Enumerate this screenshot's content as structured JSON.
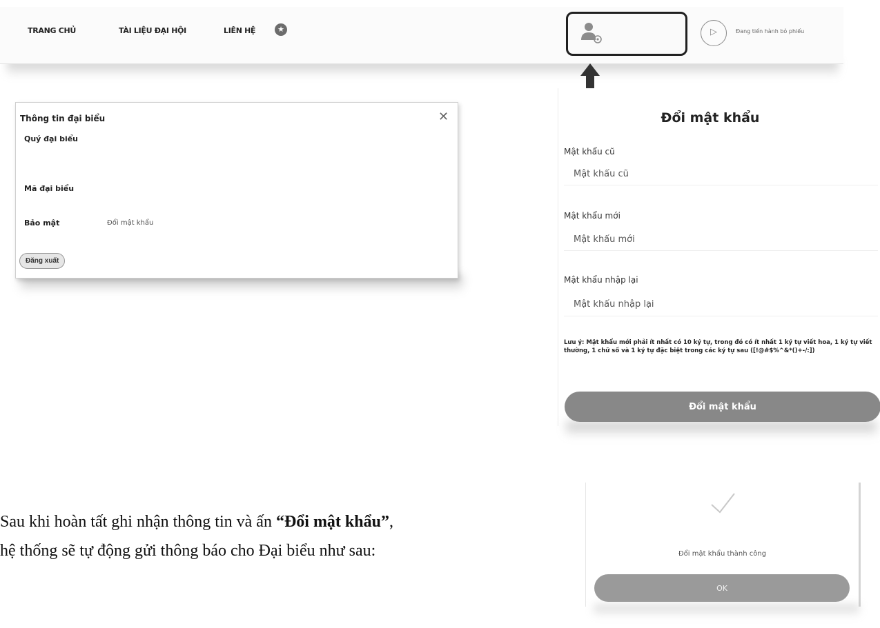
{
  "nav": {
    "home": "TRANG CHỦ",
    "documents": "TÀI LIỆU ĐẠI HỘI",
    "contact": "LIÊN HỆ",
    "voting_status": "Đang tiến hành bỏ phiếu",
    "star_icon": "star-icon",
    "user_icon": "user-settings-icon",
    "vote_icon": "send-icon"
  },
  "info_dialog": {
    "title": "Thông tin đại biểu",
    "label_title": "Quý đại biểu",
    "label_code": "Mã đại biểu",
    "label_security": "Bảo mật",
    "change_password_link": "Đổi mật khẩu",
    "logout_button": "Đăng xuất"
  },
  "change_password": {
    "title": "Đổi mật khẩu",
    "old_label": "Mật khẩu cũ",
    "old_placeholder": "Mật khẩu cũ",
    "new_label": "Mật khẩu mới",
    "new_placeholder": "Mật khẩu mới",
    "confirm_label": "Mật khẩu nhập lại",
    "confirm_placeholder": "Mật khẩu nhập lại",
    "note": "Lưu ý: Mật khẩu mới phải ít nhất có 10 ký tự, trong đó có ít nhất 1 ký tự viết hoa, 1 ký tự viết thường, 1 chữ số và 1 ký tự đặc biệt trong các ký tự sau ([!@#$%^&*()+-/:])",
    "submit": "Đổi mật khẩu"
  },
  "instruction": {
    "part1": "Sau khi hoàn tất ghi nhận thông tin và ấn ",
    "bold": "“Đổi mật khẩu”",
    "part2": ",",
    "line2": "hệ thống sẽ tự động gửi thông báo cho Đại biểu như sau:"
  },
  "success_dialog": {
    "message": "Đổi mật khẩu thành công",
    "ok": "OK",
    "check_icon": "checkmark-icon"
  },
  "colors": {
    "button_gray": "#888888",
    "highlight_border": "#202020"
  }
}
